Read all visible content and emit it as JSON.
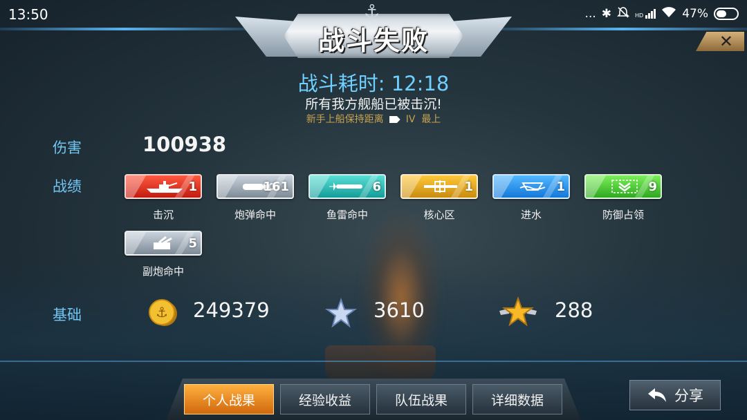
{
  "status_bar": {
    "time": "13:50",
    "dots": "...",
    "bluetooth": "✱",
    "bell_off": "🔕",
    "signal_label": "HD",
    "battery_percent": "47%"
  },
  "header": {
    "title": "战斗失败",
    "duration_label": "战斗耗时: 12:18",
    "subtitle": "所有我方舰船已被击沉!",
    "hint_text": "新手上船保持距离",
    "hint_tier": "IV",
    "hint_rank": "最上",
    "close_symbol": "✕"
  },
  "damage": {
    "label": "伤害",
    "value": "100938"
  },
  "record": {
    "label": "战绩",
    "badges": [
      {
        "name": "击沉",
        "count": "1",
        "color": "red",
        "icon": "ship-icon"
      },
      {
        "name": "炮弹命中",
        "count": "161",
        "color": "grey",
        "icon": "shell-icon"
      },
      {
        "name": "鱼雷命中",
        "count": "6",
        "color": "teal",
        "icon": "torpedo-icon"
      },
      {
        "name": "核心区",
        "count": "1",
        "color": "gold",
        "icon": "citadel-icon"
      },
      {
        "name": "进水",
        "count": "1",
        "color": "blue",
        "icon": "flooding-icon"
      },
      {
        "name": "防御占领",
        "count": "9",
        "color": "green",
        "icon": "defense-icon"
      },
      {
        "name": "副炮命中",
        "count": "5",
        "color": "grey",
        "icon": "secondary-gun-icon"
      }
    ]
  },
  "base": {
    "label": "基础",
    "credits": "249379",
    "exp": "3610",
    "captain_exp": "288"
  },
  "tabs": [
    {
      "label": "个人战果",
      "active": true
    },
    {
      "label": "经验收益",
      "active": false
    },
    {
      "label": "队伍战果",
      "active": false
    },
    {
      "label": "详细数据",
      "active": false
    }
  ],
  "share": {
    "label": "分享",
    "icon": "back-arrow-icon"
  },
  "colors": {
    "accent_blue": "#6fd0ff",
    "label_blue": "#72c6f4",
    "active_tab": "#f08a20"
  }
}
